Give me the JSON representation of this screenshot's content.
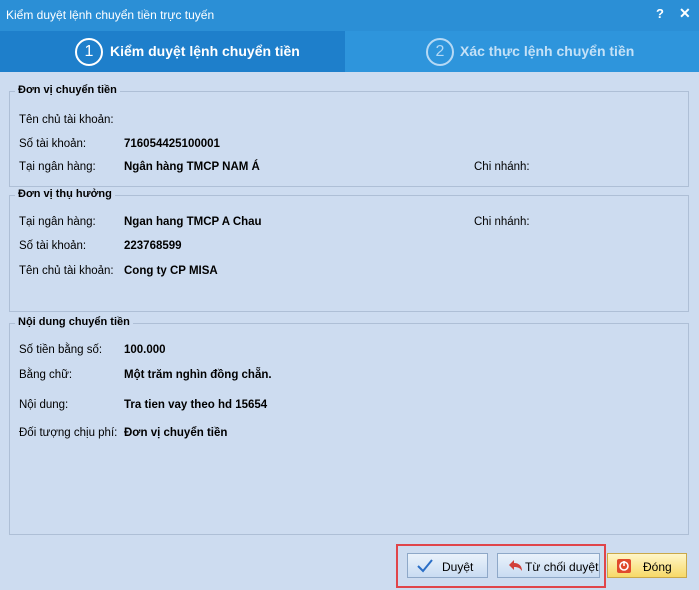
{
  "window": {
    "title": "Kiểm duyệt lệnh chuyển tiền trực tuyến",
    "help": "?",
    "close": "✕"
  },
  "wizard": {
    "step1": {
      "number": "1",
      "label": "Kiểm duyệt lệnh chuyển tiền"
    },
    "step2": {
      "number": "2",
      "label": "Xác thực lệnh chuyển tiền"
    }
  },
  "sender": {
    "title": "Đơn vị chuyển tiền",
    "owner_label": "Tên chủ tài khoản:",
    "owner_value": "",
    "account_label": "Số tài khoản:",
    "account_value": "716054425100001",
    "bank_label": "Tại ngân hàng:",
    "bank_value": "Ngân hàng TMCP NAM Á",
    "branch_label": "Chi nhánh:",
    "branch_value": ""
  },
  "receiver": {
    "title": "Đơn vị thụ hưởng",
    "bank_label": "Tại ngân hàng:",
    "bank_value": "Ngan hang TMCP A Chau",
    "branch_label": "Chi nhánh:",
    "branch_value": "",
    "account_label": "Số tài khoản:",
    "account_value": "223768599",
    "owner_label": "Tên chủ tài khoản:",
    "owner_value": "Cong ty CP MISA"
  },
  "transfer": {
    "title": "Nội dung chuyển tiền",
    "amount_label": "Số tiền bằng số:",
    "amount_value": "100.000",
    "words_label": "Bằng chữ:",
    "words_value": "Một trăm nghìn đồng chẵn.",
    "content_label": "Nội dung:",
    "content_value": "Tra tien vay theo hd 15654",
    "fee_label": "Đối tượng chịu phí:",
    "fee_value": "Đơn vị chuyển tiền"
  },
  "buttons": {
    "approve": "Duyệt",
    "reject": "Từ chối duyệt",
    "close": "Đóng"
  },
  "icons": {
    "approve": "check-icon",
    "reject": "undo-arrow-icon",
    "close": "power-icon"
  },
  "colors": {
    "title_bar": "#2b8fd6",
    "active_step": "#1e7fcb",
    "background": "#cddcf0",
    "highlight": "#e0454a"
  }
}
